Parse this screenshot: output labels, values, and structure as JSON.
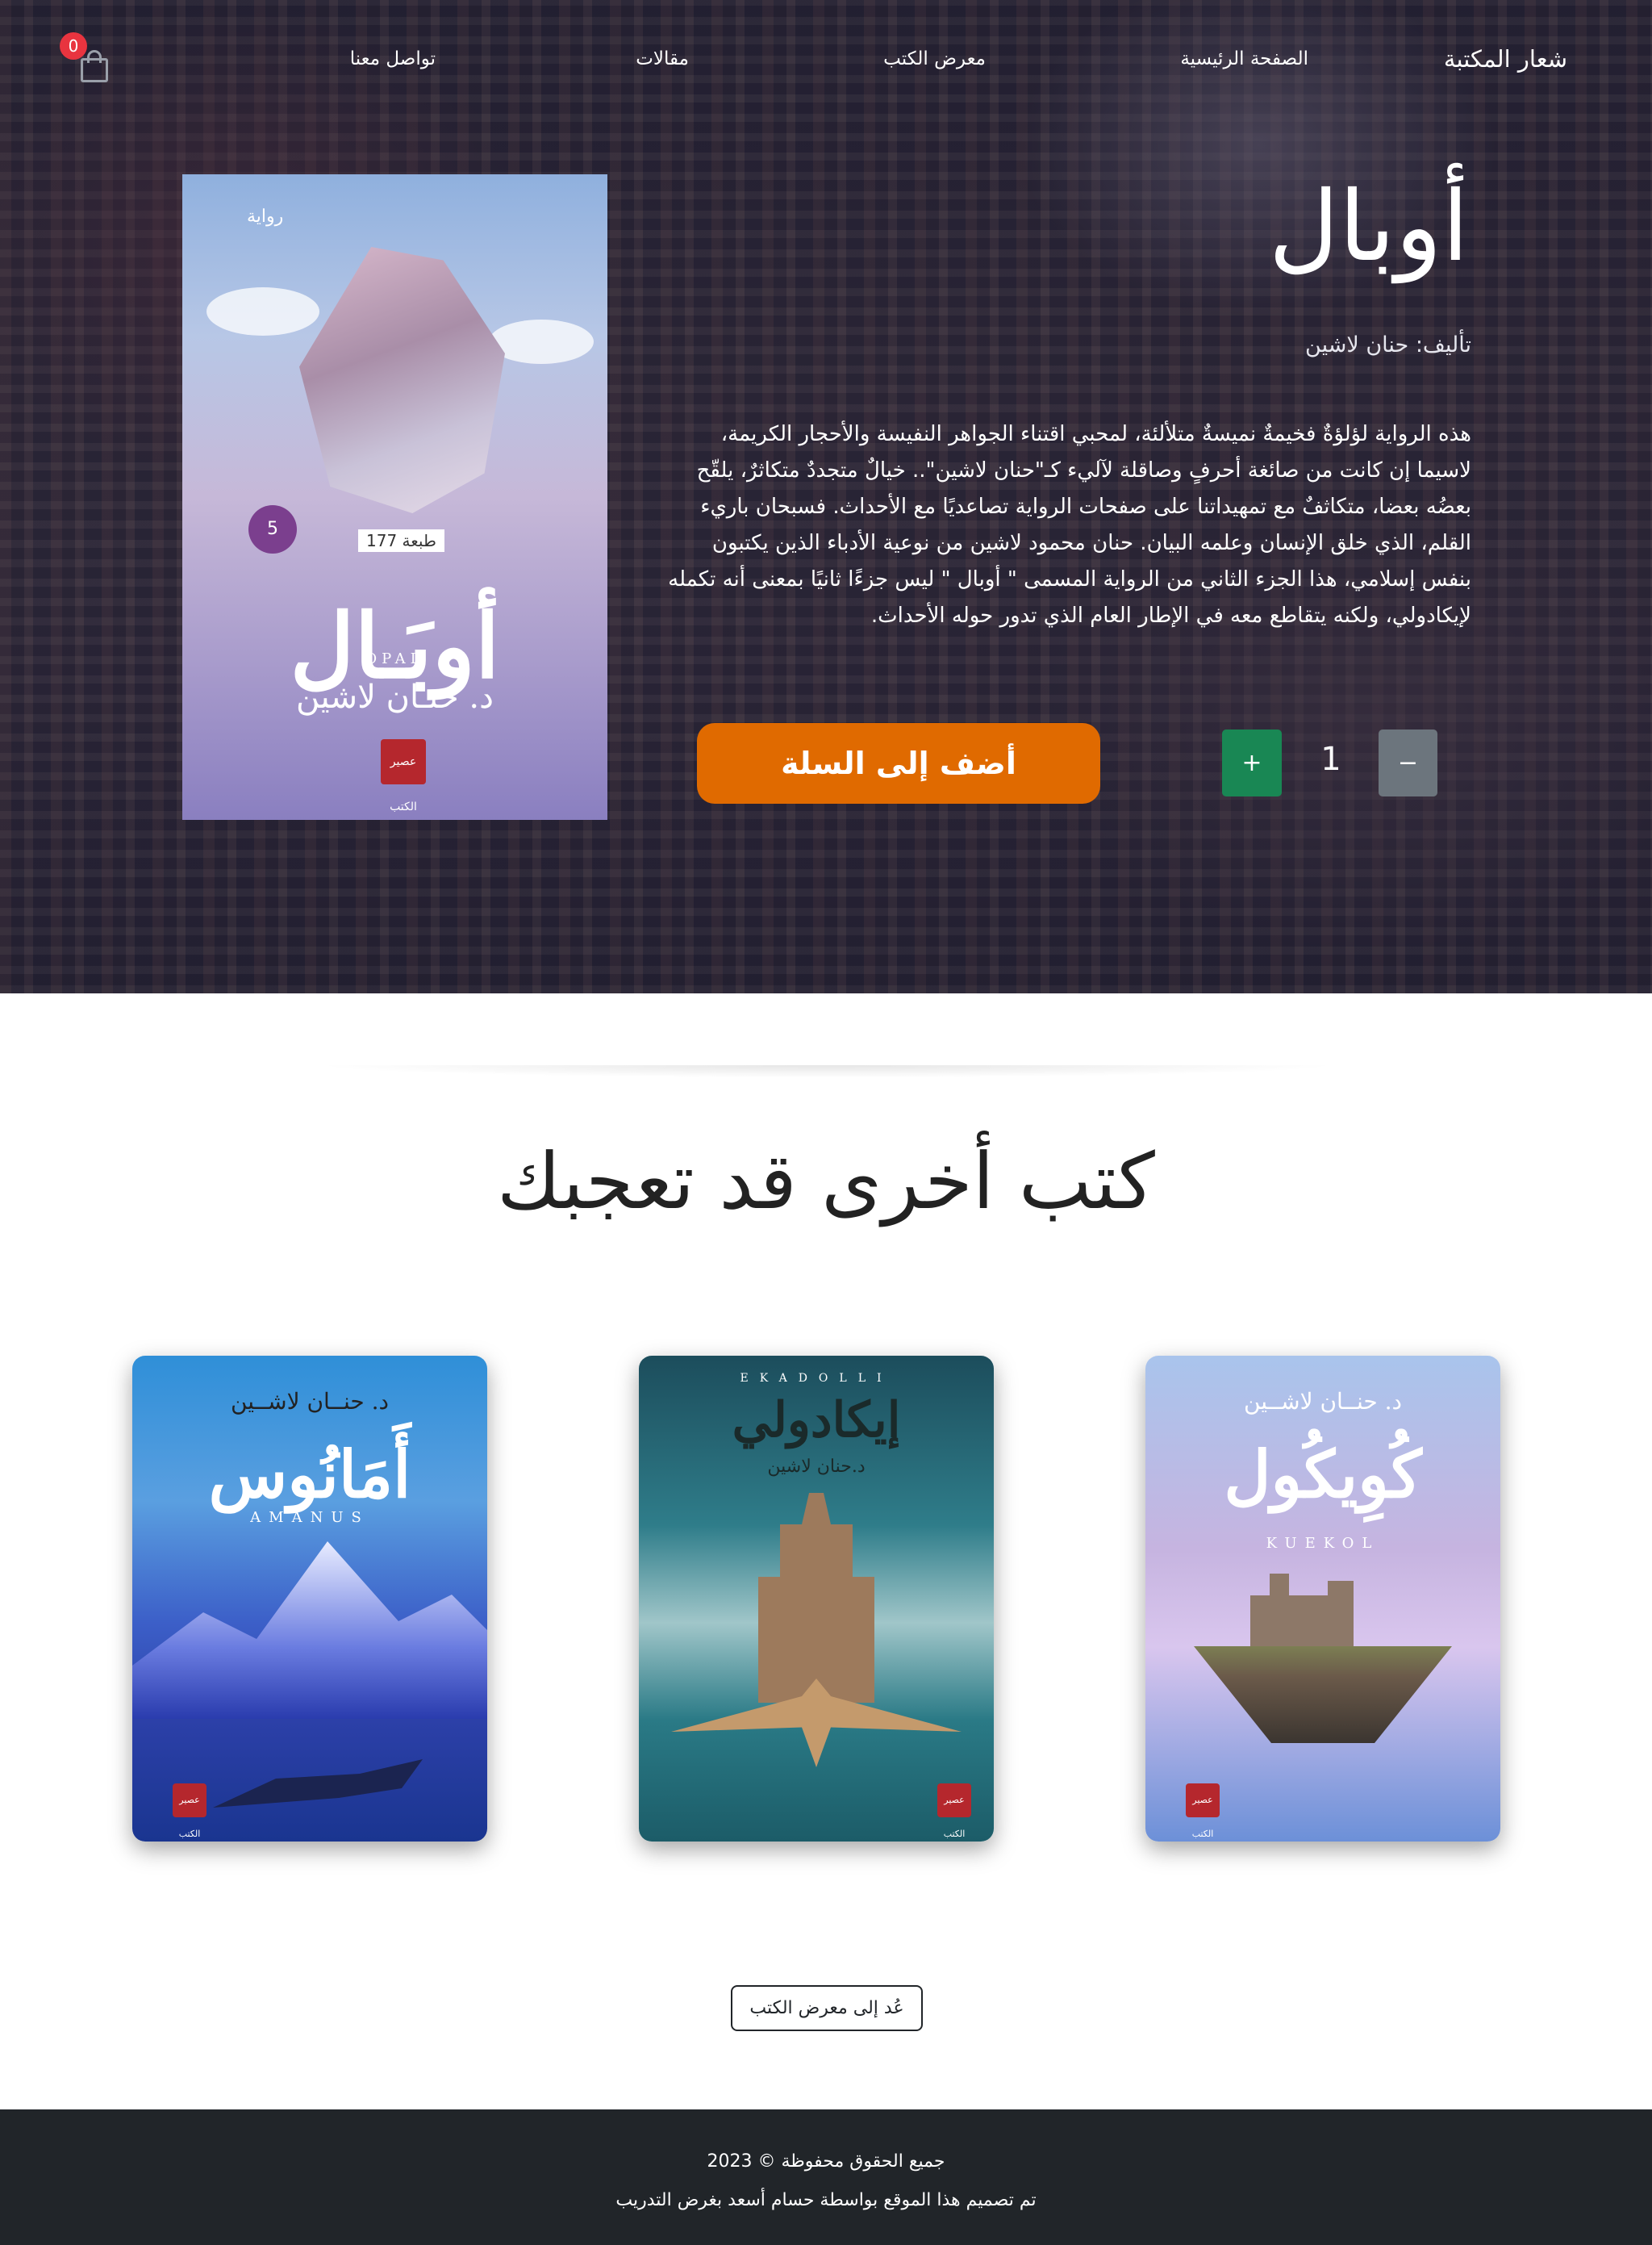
{
  "nav": {
    "brand": "شعار المكتبة",
    "links": [
      "الصفحة الرئيسية",
      "معرض الكتب",
      "مقالات",
      "تواصل معنا"
    ],
    "cart_count": "0"
  },
  "book": {
    "title": "أوبال",
    "author": "تأليف: حنان لاشين",
    "description": "هذه الرواية لؤلؤةٌ فخيمةٌ نميسةٌ متلألئة، لمحبي اقتناء الجواهر النفيسة والأحجار الكريمة، لاسيما إن كانت من صائغة أحرفٍ وصاقلة لآليء كـ\"حنان لاشين\".. خيالٌ متجددٌ متكاثرٌ، يلقّح بعضُه بعضا، متكاثفٌ مع تمهيداتنا على صفحات الرواية تصاعديًا مع الأحداث. فسبحان باريء القلم، الذي خلق الإنسان وعلمه البيان. حنان محمود لاشين من نوعية الأدباء الذين يكتبون بنفس إسلامي، هذا الجزء الثاني من الرواية المسمى \" أوبال \" ليس جزءًا ثانيًا بمعنى أنه تكمله لإيكادولي، ولكنه يتقاطع معه في الإطار العام الذي تدور حوله الأحداث.",
    "cover": {
      "top_label": "رواية",
      "title": "أوبَـال",
      "latin": "OPAL",
      "author": "د. حنـان لاشين",
      "edition": "طبعة 177",
      "badge": "5",
      "publisher": "عصير الكتب"
    },
    "quantity": "1",
    "minus": "−",
    "plus": "+",
    "add_to_cart": "أضف إلى السلة"
  },
  "related": {
    "title": "كتب أخرى قد تعجبك",
    "books": [
      {
        "author": "د. حنــان لاشــين",
        "title": "كُوِيكُول",
        "subtitle": "KUEKOL",
        "publisher": "عصير الكتب"
      },
      {
        "latin": "EKADOLLI",
        "title": "إيكادولي",
        "author": "د.حنان لاشين",
        "publisher": "عصير الكتب"
      },
      {
        "author": "د. حنــان لاشــين",
        "title": "أَمَانُوس",
        "subtitle": "AMANUS",
        "publisher": "عصير الكتب"
      }
    ],
    "back_button": "عُد إلى معرض الكتب"
  },
  "footer": {
    "copyright": "جميع الحقوق محفوظة © 2023",
    "credit": "تم تصميم هذا الموقع بواسطة حسام أسعد بغرض التدريب"
  },
  "colors": {
    "add_to_cart": "#e06a00",
    "plus": "#198754",
    "minus": "#6c757d",
    "cart_badge": "#e8343f",
    "footer": "#212529"
  }
}
